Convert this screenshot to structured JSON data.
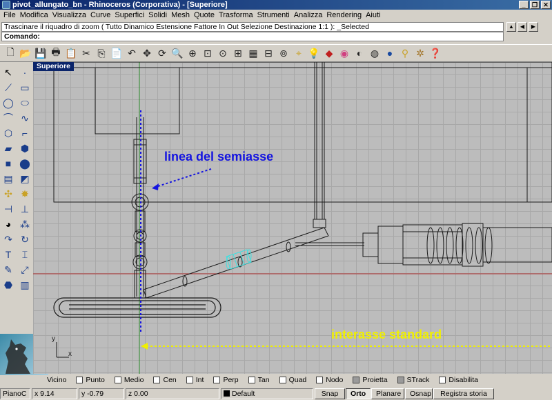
{
  "window": {
    "title": "pivot_allungato_bn - Rhinoceros (Corporativa) - [Superiore]"
  },
  "menu": [
    "File",
    "Modifica",
    "Visualizza",
    "Curve",
    "Superfici",
    "Solidi",
    "Mesh",
    "Quote",
    "Trasforma",
    "Strumenti",
    "Analizza",
    "Rendering",
    "Aiuti"
  ],
  "command": {
    "history": "Trascinare il riquadro di zoom ( Tutto  Dinamico  Estensione  Fattore  In  Out  Selezione  Destinazione  1:1 ): _Selected",
    "prompt": "Comando:"
  },
  "viewport": {
    "name": "Superiore",
    "annotation_axle": "linea del semiasse",
    "annotation_wheelbase": "interasse standard",
    "axis_y": "y",
    "axis_x": "x",
    "colors": {
      "background": "#bcbcbc",
      "grid": "#a8a8a8",
      "blue_note": "#1414e0",
      "yellow_note": "#f0f000",
      "red_axis": "#b03030",
      "green_axis": "#2a8a2a",
      "highlight": "#3ee0e0"
    }
  },
  "toolbar_top_icons": [
    "new-icon",
    "open-icon",
    "save-icon",
    "print-icon",
    "clipboard-icon",
    "cut-icon",
    "copy-icon",
    "paste-icon",
    "undo-icon",
    "pan-icon",
    "rotate-view-icon",
    "zoom-window-icon",
    "zoom-dynamic-icon",
    "zoom-extents-icon",
    "zoom-selected-icon",
    "four-viewports-icon",
    "grid-icon",
    "camera-icon",
    "snap-icon",
    "help-point-icon",
    "light-icon",
    "layer-icon",
    "color-wheel-icon",
    "sphere-shade-icon",
    "render-icon",
    "render-sphere-icon",
    "wand-icon",
    "settings-icon",
    "help-icon"
  ],
  "snap": {
    "items": [
      {
        "label": "Vicino",
        "checked": false
      },
      {
        "label": "Punto",
        "checked": false
      },
      {
        "label": "Medio",
        "checked": false
      },
      {
        "label": "Cen",
        "checked": false
      },
      {
        "label": "Int",
        "checked": false
      },
      {
        "label": "Perp",
        "checked": false
      },
      {
        "label": "Tan",
        "checked": false
      },
      {
        "label": "Quad",
        "checked": false
      },
      {
        "label": "Nodo",
        "checked": false
      },
      {
        "label": "Proietta",
        "checked": true
      },
      {
        "label": "STrack",
        "checked": true
      },
      {
        "label": "Disabilita",
        "checked": false
      }
    ]
  },
  "status": {
    "cplane": "PianoC",
    "x": "x 9.14",
    "y": "y -0.79",
    "z": "z 0.00",
    "layer": "Default",
    "snap": "Snap",
    "ortho": "Orto",
    "planar": "Planare",
    "osnap": "Osnap",
    "history": "Registra storia"
  }
}
